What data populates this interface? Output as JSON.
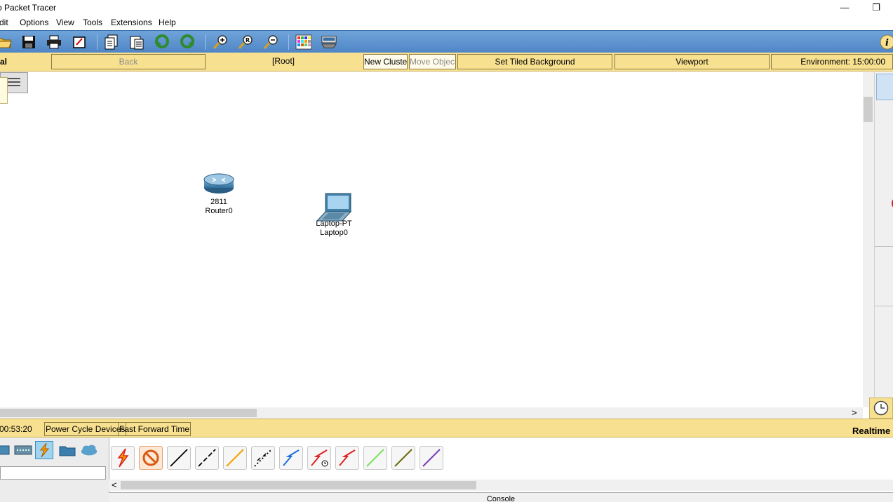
{
  "window": {
    "title": "o Packet Tracer",
    "minimize": "—",
    "restore": "❐"
  },
  "menu": [
    "dit",
    "Options",
    "View",
    "Tools",
    "Extensions",
    "Help"
  ],
  "toolbar": {
    "icons": [
      "open-icon",
      "save-icon",
      "print-icon",
      "activity-wizard-icon",
      "copy-icon",
      "paste-icon",
      "undo-icon",
      "redo-icon",
      "zoom-in-icon",
      "zoom-reset-icon",
      "zoom-out-icon",
      "palette-icon",
      "custom-device-icon",
      "info-icon"
    ],
    "info_label": "i"
  },
  "logical_bar": {
    "mode_label": "al",
    "back": "Back",
    "root": "[Root]",
    "new_cluster": "New Cluster",
    "move_object": "Move Object",
    "set_tiled_background": "Set Tiled Background",
    "viewport": "Viewport",
    "environment": "Environment: 15:00:00"
  },
  "devices": [
    {
      "model": "2811",
      "name": "Router0",
      "type": "router"
    },
    {
      "model": "Laptop-PT",
      "name": "Laptop0",
      "type": "laptop"
    }
  ],
  "time_bar": {
    "clock": "00:53:20",
    "power_cycle": "Power Cycle Devices",
    "fast_forward": "Fast Forward Time",
    "mode": "Realtime"
  },
  "bottom": {
    "categories": [
      "switch-icon",
      "hub-icon",
      "connections-icon",
      "misc-icon",
      "cloud-icon"
    ],
    "cables": [
      "automatic-connection-icon",
      "console-cable-icon",
      "straight-through-icon",
      "crossover-icon",
      "fiber-icon",
      "phone-icon",
      "coaxial-icon",
      "serial-dce-icon",
      "serial-dte-icon",
      "octal-icon",
      "iot-custom-icon",
      "usb-icon"
    ],
    "console_tab": "Console",
    "scroll_left": "<",
    "scroll_right": ">"
  },
  "colors": {
    "toolbar": "#5a90cf",
    "logic_bar": "#f7e08f",
    "workspace": "#ffffff"
  }
}
